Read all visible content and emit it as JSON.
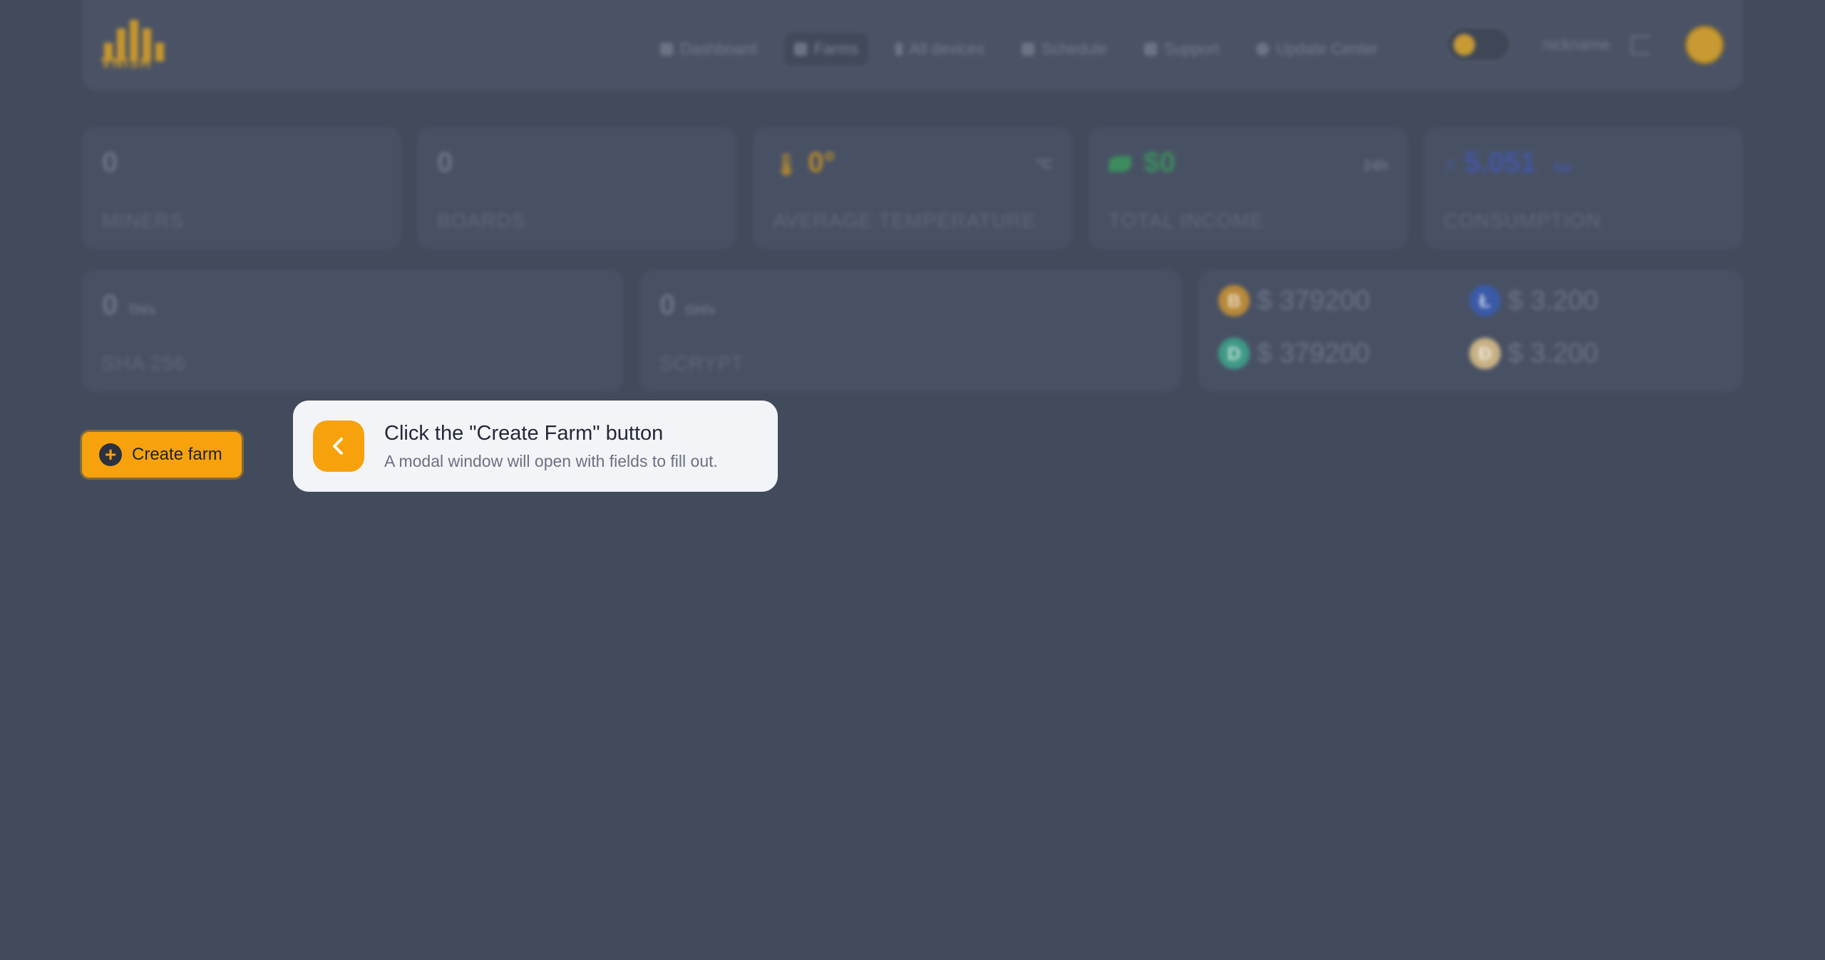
{
  "header": {
    "logo_text": "VNISH",
    "nav": [
      {
        "label": "Dashboard",
        "icon": "grid-icon"
      },
      {
        "label": "Farms",
        "icon": "share-icon",
        "active": true
      },
      {
        "label": "All devices",
        "icon": "bolt-icon"
      },
      {
        "label": "Schedule",
        "icon": "calendar-icon"
      },
      {
        "label": "Support",
        "icon": "chat-icon"
      },
      {
        "label": "Update Center",
        "icon": "gear-icon"
      }
    ],
    "nickname": "nickname"
  },
  "stats": [
    {
      "value": "0",
      "label": "MINERS"
    },
    {
      "value": "0",
      "label": "BOARDS"
    },
    {
      "value": "0°",
      "label": "AVERAGE TEMPERATURE",
      "unit": "°C"
    },
    {
      "value": "$0",
      "label": "TOTAL INCOME",
      "unit": "24h"
    },
    {
      "value": "5.051",
      "label": "CONSUMPTION",
      "unit": "kw"
    }
  ],
  "hashrate": [
    {
      "value": "0",
      "unit": "TH/s",
      "label": "SHA 256"
    },
    {
      "value": "0",
      "unit": "GH/s",
      "label": "SCRYPT"
    }
  ],
  "prices": [
    {
      "symbol": "B",
      "value": "$ 379200",
      "color": "#b8893a"
    },
    {
      "symbol": "Ł",
      "value": "$ 3.200",
      "color": "#3a5aa8"
    },
    {
      "symbol": "D",
      "value": "$ 379200",
      "color": "#3e9a86"
    },
    {
      "symbol": "Ð",
      "value": "$ 3.200",
      "color": "#c7b184"
    }
  ],
  "create_button": {
    "label": "Create farm"
  },
  "tooltip": {
    "title": "Click the \"Create Farm\" button",
    "description": "A modal window will open with fields to fill out."
  },
  "colors": {
    "accent": "#f7a20c",
    "background": "#424b5c"
  }
}
